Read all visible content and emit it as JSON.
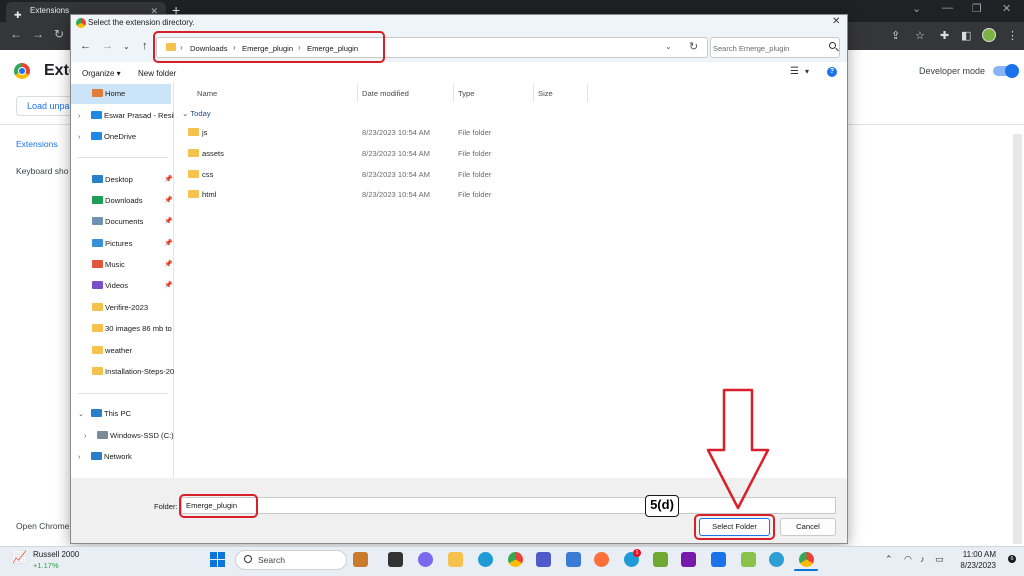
{
  "browser": {
    "tab_title": "Extensions",
    "tab_close": "✕",
    "new_tab": "+",
    "window_controls": [
      "⌄",
      "—",
      "❐",
      "✕"
    ]
  },
  "extensions_page": {
    "title": "Exte",
    "developer_mode_label": "Developer mode",
    "developer_mode_on": 1,
    "load_unpacked": "Load unpa",
    "side_extensions": "Extensions",
    "side_keyboard": "Keyboard sho",
    "side_open_chrome": "Open Chrome"
  },
  "dialog": {
    "title": "Select the extension directory.",
    "close": "✕",
    "breadcrumb": [
      "Downloads",
      "Emerge_plugin",
      "Emerge_plugin"
    ],
    "crumb_sep": "›",
    "search_placeholder": "Search Emerge_plugin",
    "organize": "Organize ▾",
    "new_folder": "New folder",
    "help": "?",
    "nav": {
      "home": "Home",
      "cloud": [
        "Eswar Prasad - Resil",
        "OneDrive"
      ],
      "quick": [
        "Desktop",
        "Downloads",
        "Documents",
        "Pictures",
        "Music",
        "Videos"
      ],
      "folders": [
        "Verifire-2023",
        "30 images  86 mb to",
        "weather",
        "Installation-Steps-20"
      ],
      "this_pc": "This PC",
      "drive": "Windows-SSD (C:)",
      "network": "Network",
      "pin": "📌",
      "expand": "›",
      "expanded": "⌄"
    },
    "columns": [
      "Name",
      "Date modified",
      "Type",
      "Size"
    ],
    "group": "Today",
    "group_chevron": "⌄",
    "files": [
      {
        "name": "js",
        "date": "8/23/2023 10:54 AM",
        "type": "File folder"
      },
      {
        "name": "assets",
        "date": "8/23/2023 10:54 AM",
        "type": "File folder"
      },
      {
        "name": "css",
        "date": "8/23/2023 10:54 AM",
        "type": "File folder"
      },
      {
        "name": "html",
        "date": "8/23/2023 10:54 AM",
        "type": "File folder"
      }
    ],
    "folder_label": "Folder:",
    "folder_value": "Emerge_plugin",
    "select_button": "Select Folder",
    "cancel_button": "Cancel"
  },
  "annotation": {
    "step": "5(d)",
    "color": "#d9202a"
  },
  "taskbar": {
    "stock_name": "Russell 2000",
    "stock_change": "+1.17%",
    "search": "Search",
    "badge_1": "1",
    "badge_2": "6",
    "time": "11:00 AM",
    "date": "8/23/2023"
  }
}
